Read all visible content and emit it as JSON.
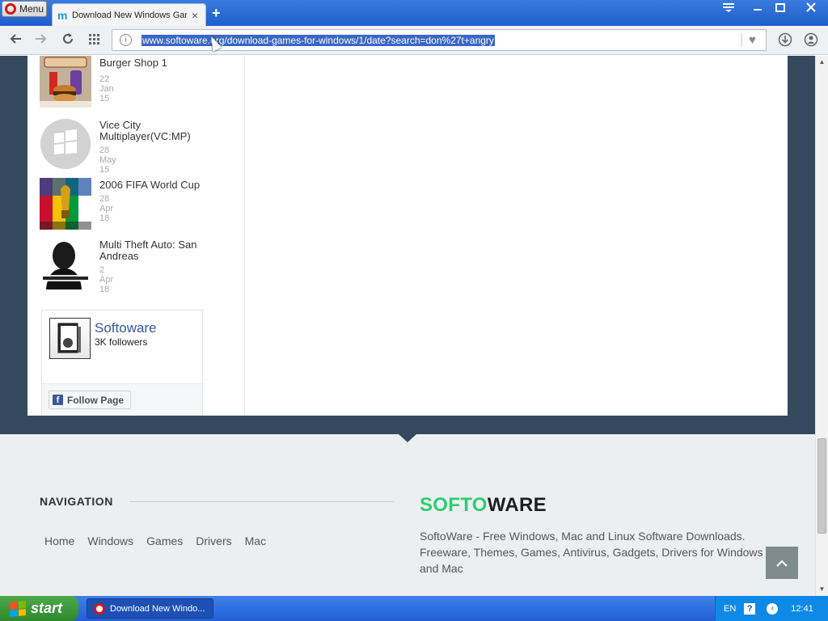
{
  "browser": {
    "menu_label": "Menu",
    "tab_title": "Download New Windows Games",
    "tab_close": "×",
    "new_tab": "+",
    "url": "www.softoware.org/download-games-for-windows/1/date?search=don%27t+angry",
    "icons": [
      "back-icon",
      "forward-icon",
      "reload-icon",
      "speed-dial-icon",
      "site-info-icon",
      "heart-icon",
      "download-icon",
      "account-icon",
      "tab-menu-icon",
      "minimize-icon",
      "maximize-icon",
      "close-icon"
    ]
  },
  "sidebar": {
    "games": [
      {
        "name": "Burger Shop 1",
        "date": "22 Jan 15"
      },
      {
        "name": "Vice City Multiplayer(VC:MP)",
        "date": "28 May 15"
      },
      {
        "name": "2006 FIFA World Cup",
        "date": "28 Apr 18"
      },
      {
        "name": "Multi Theft Auto: San Andreas",
        "date": "2 Apr 18"
      }
    ],
    "facebook": {
      "page_name": "Softoware",
      "followers": "3K followers",
      "follow_label": "Follow Page",
      "f_glyph": "f"
    }
  },
  "footer": {
    "nav_heading": "NAVIGATION",
    "nav_links": [
      "Home",
      "Windows",
      "Games",
      "Drivers",
      "Mac"
    ],
    "brand_part1": "SOFTO",
    "brand_part2": "WARE",
    "description": "SoftoWare - Free Windows, Mac and Linux Software Downloads. Freeware, Themes, Games, Antivirus, Gadgets, Drivers for Windows and Mac",
    "to_top_icon": "chevron-up-icon"
  },
  "taskbar": {
    "start_label": "start",
    "task_label": "Download New Windo...",
    "lang": "EN",
    "help": "?",
    "time": "12:41"
  },
  "colors": {
    "dark_band": "#34495e",
    "brand_green": "#2ecc71",
    "facebook_blue": "#3b5998"
  }
}
